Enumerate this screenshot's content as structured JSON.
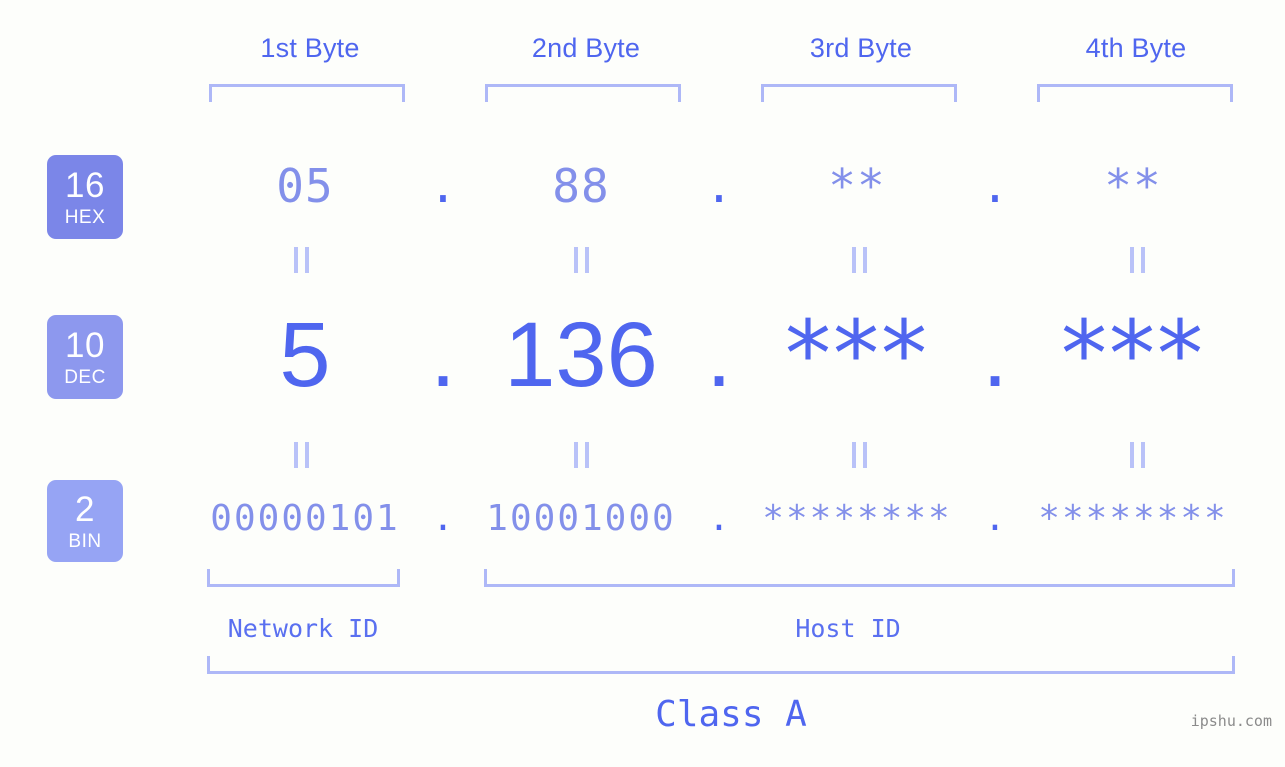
{
  "watermark": "ipshu.com",
  "byte_headers": [
    {
      "label": "1st Byte"
    },
    {
      "label": "2nd Byte"
    },
    {
      "label": "3rd Byte"
    },
    {
      "label": "4th Byte"
    }
  ],
  "bases": [
    {
      "num": "16",
      "name": "HEX",
      "color": "#7b86e8"
    },
    {
      "num": "10",
      "name": "DEC",
      "color": "#8d98ee"
    },
    {
      "num": "2",
      "name": "BIN",
      "color": "#96a4f4"
    }
  ],
  "rows": {
    "hex": {
      "base_num": "16",
      "base_name": "HEX",
      "values": [
        "05",
        "88",
        "**",
        "**"
      ],
      "separator": "."
    },
    "dec": {
      "base_num": "10",
      "base_name": "DEC",
      "values": [
        "5",
        "136",
        "***",
        "***"
      ],
      "separator": "."
    },
    "bin": {
      "base_num": "2",
      "base_name": "BIN",
      "values": [
        "00000101",
        "10001000",
        "********",
        "********"
      ],
      "separator": "."
    }
  },
  "equals_symbol": "||",
  "sections": [
    {
      "label": "Network ID"
    },
    {
      "label": "Host ID"
    }
  ],
  "class": {
    "label": "Class A"
  },
  "colors": {
    "background": "#fdfefb",
    "accent_strong": "#4f66ef",
    "accent_mid": "#8390ea",
    "accent_light": "#aeb8f7",
    "connector": "#b9c2f8",
    "watermark": "#8b8b8b"
  }
}
